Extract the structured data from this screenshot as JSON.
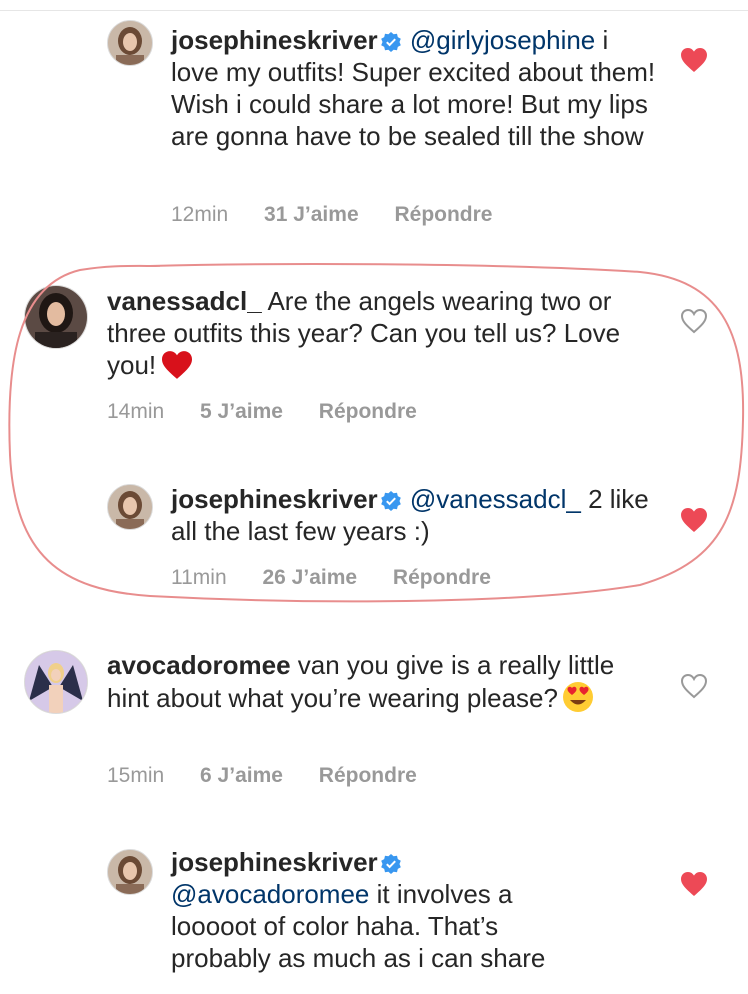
{
  "comments": [
    {
      "username": "josephineskriver",
      "verified": true,
      "mention": "@girlyjosephine",
      "text": "i love my outfits! Super excited about them! Wish i could share a lot more! But my lips are gonna have to be sealed till the show",
      "time": "12min",
      "likes": "31 J’aime",
      "reply": "Répondre",
      "liked": true
    },
    {
      "username": "vanessadcl_",
      "verified": false,
      "text": "Are the angels wearing two or three outfits this year? Can you tell us? Love you!",
      "emoji": "red-heart",
      "time": "14min",
      "likes": "5 J’aime",
      "reply": "Répondre",
      "liked": false
    },
    {
      "username": "josephineskriver",
      "verified": true,
      "mention": "@vanessadcl_",
      "text": "2 like all the last few years :)",
      "time": "11min",
      "likes": "26 J’aime",
      "reply": "Répondre",
      "liked": true
    },
    {
      "username": "avocadoromee",
      "verified": false,
      "text": "van you give is a really little hint about what you’re wearing please?",
      "emoji": "heart-eyes",
      "time": "15min",
      "likes": "6 J’aime",
      "reply": "Répondre",
      "liked": false
    },
    {
      "username": "josephineskriver",
      "verified": true,
      "mention": "@avocadoromee",
      "text": "it involves a looooot of color haha. That’s probably as much as i can share",
      "liked": true
    }
  ],
  "colors": {
    "text": "#262626",
    "mention": "#003569",
    "meta": "#999999",
    "heart_liked": "#ed4956",
    "verified": "#3897f0",
    "annotation": "#e88d8d"
  }
}
